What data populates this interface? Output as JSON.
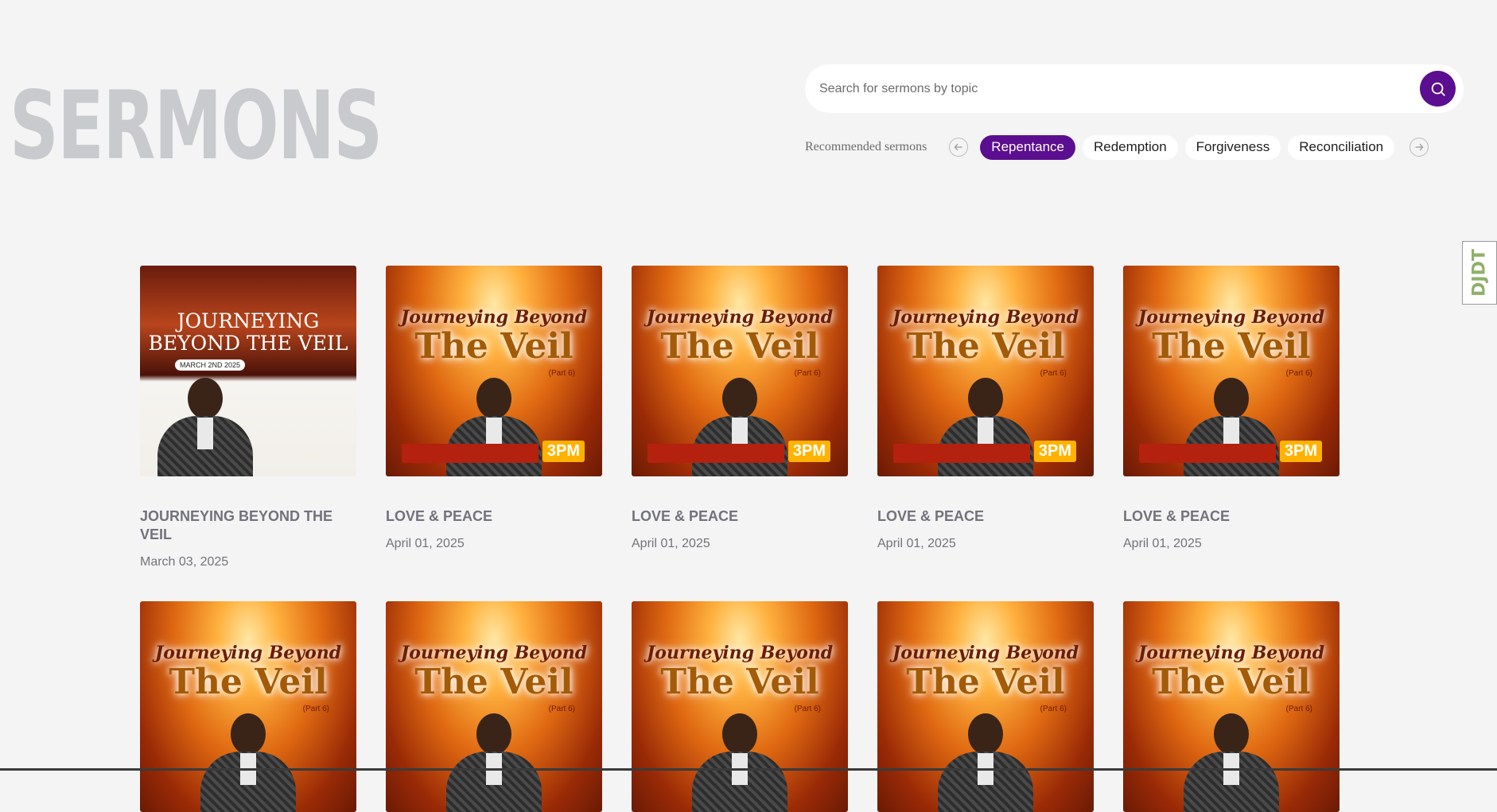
{
  "page": {
    "title": "SERMONS"
  },
  "search": {
    "placeholder": "Search for sermons by topic"
  },
  "recommended": {
    "label": "Recommended sermons",
    "topics": [
      "Repentance",
      "Redemption",
      "Forgiveness",
      "Reconciliation"
    ],
    "active_topic": "Repentance",
    "prev_icon": "arrow-left-icon",
    "next_icon": "arrow-right-icon"
  },
  "colors": {
    "accent": "#5b0e8f",
    "title_gray": "#c9cacd",
    "text_gray": "#72737a"
  },
  "sermons": [
    {
      "title": "JOURNEYING BEYOND THE VEIL",
      "date": "March 03, 2025"
    },
    {
      "title": "LOVE & PEACE",
      "date": "April 01, 2025"
    },
    {
      "title": "LOVE & PEACE",
      "date": "April 01, 2025"
    },
    {
      "title": "LOVE & PEACE",
      "date": "April 01, 2025"
    },
    {
      "title": "LOVE & PEACE",
      "date": "April 01, 2025"
    }
  ],
  "flyer": {
    "first_line1": "JOURNEYING",
    "first_line2": "BEYOND THE VEIL",
    "first_date": "MARCH 2ND 2025",
    "line1": "Journeying Beyond",
    "line2": "The Veil",
    "part": "(Part 6)",
    "time": "3PM"
  },
  "side_badge": {
    "text": "DJDT"
  }
}
